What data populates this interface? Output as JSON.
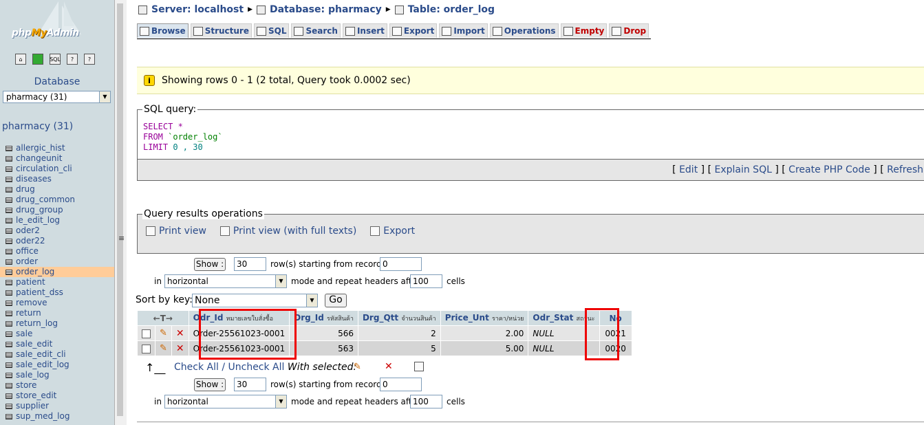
{
  "sidebar": {
    "logo": {
      "php": "php",
      "my": "My",
      "admin": "Admin"
    },
    "db_label": "Database",
    "db_select_value": "pharmacy (31)",
    "db_heading": "pharmacy (31)",
    "tables": [
      "allergic_hist",
      "changeunit",
      "circulation_cli",
      "diseases",
      "drug",
      "drug_common",
      "drug_group",
      "le_edit_log",
      "oder2",
      "oder22",
      "office",
      "order",
      "order_log",
      "patient",
      "patient_dss",
      "remove",
      "return",
      "return_log",
      "sale",
      "sale_edit",
      "sale_edit_cli",
      "sale_edit_log",
      "sale_log",
      "store",
      "store_edit",
      "supplier",
      "sup_med_log"
    ],
    "active_table": "order_log"
  },
  "breadcrumb": {
    "server": "Server: localhost",
    "database": "Database: pharmacy",
    "table": "Table: order_log"
  },
  "tabs": [
    {
      "label": "Browse"
    },
    {
      "label": "Structure"
    },
    {
      "label": "SQL"
    },
    {
      "label": "Search"
    },
    {
      "label": "Insert"
    },
    {
      "label": "Export"
    },
    {
      "label": "Import"
    },
    {
      "label": "Operations"
    },
    {
      "label": "Empty"
    },
    {
      "label": "Drop"
    }
  ],
  "notice": "Showing rows 0 - 1 (2 total, Query took 0.0002 sec)",
  "sql_query": {
    "legend": "SQL query:",
    "select_kw": "SELECT",
    "select_val": " *",
    "from_kw": "FROM",
    "from_val": " `order_log`",
    "limit_kw": "LIMIT",
    "limit_val": " 0 , 30",
    "links": {
      "open": "[ ",
      "edit": "Edit",
      "sep": " ] [ ",
      "explain": "Explain SQL",
      "create": "Create PHP Code",
      "refresh": "Refresh"
    }
  },
  "qro": {
    "legend": "Query results operations",
    "print_view": "Print view",
    "print_full": "Print view (with full texts)",
    "export": "Export"
  },
  "nav": {
    "show_label": "Show :",
    "rows_value": "30",
    "rows_text": "row(s) starting from record #",
    "start_value": "0",
    "in_text": "in",
    "mode_value": "horizontal",
    "mode_text": "mode and repeat headers after",
    "headers_value": "100",
    "cells_text": "cells"
  },
  "sort": {
    "label": "Sort by key:",
    "value": "None",
    "go": "Go"
  },
  "results": {
    "col_arrows": "←T→",
    "headers": [
      {
        "name": "Odr_Id",
        "sub": "หมายเลขใบสั่งซื้อ"
      },
      {
        "name": "Drg_Id",
        "sub": "รหัสสินค้า"
      },
      {
        "name": "Drg_Qtt",
        "sub": "จำนวนสินค้า"
      },
      {
        "name": "Price_Unt",
        "sub": "ราคา/หน่วย"
      },
      {
        "name": "Odr_Stat",
        "sub": "สถานะ"
      },
      {
        "name": "No",
        "sub": ""
      }
    ],
    "rows": [
      [
        "Order-25561023-0001",
        "566",
        "2",
        "2.00",
        "NULL",
        "0021"
      ],
      [
        "Order-25561023-0001",
        "563",
        "5",
        "5.00",
        "NULL",
        "0020"
      ]
    ]
  },
  "bulk": {
    "check_all": "Check All",
    "sep": " / ",
    "uncheck_all": "Uncheck All",
    "with_selected": "With selected:"
  },
  "colors": {
    "link": "#2a4b8a",
    "highlight": "#e00000",
    "notice_bg": "#ffffdd"
  }
}
